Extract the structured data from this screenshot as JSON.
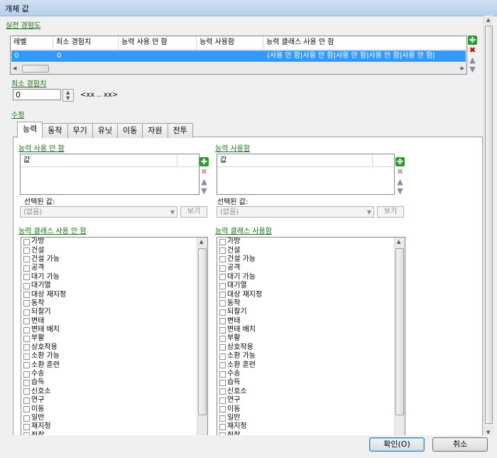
{
  "window": {
    "title": "개체 값"
  },
  "top": {
    "section_label": "실전 경험도",
    "columns": [
      "레벨",
      "최소 경험치",
      "능력 사용 안 함",
      "능력 사용함",
      "능력 클래스 사용 안 함"
    ],
    "row": [
      "0",
      "0",
      "",
      "",
      "(사용 안 함|사용 안 함|사용 안 함|사용 안 함|사용 안 함|"
    ]
  },
  "min_exp": {
    "label": "최소 경험치",
    "value": "0",
    "range": "<xx .. xx>"
  },
  "edit_label": "수정",
  "tabs": [
    "능력",
    "동작",
    "무기",
    "유닛",
    "이동",
    "자원",
    "전투"
  ],
  "left": {
    "list_label": "능력 사용 안 함",
    "list_header": "값",
    "selected_label": "선택된 값:",
    "combo_value": "(없음)",
    "view_button": "보기",
    "class_label": "능력 클래스 사용 안 함"
  },
  "right": {
    "list_label": "능력 사용함",
    "list_header": "값",
    "selected_label": "선택된 값:",
    "combo_value": "(없음)",
    "view_button": "보기",
    "class_label": "능력 클래스 사용함"
  },
  "class_items": [
    "가방",
    "건설",
    "건설 가능",
    "공격",
    "대기 가능",
    "대기열",
    "대상 재지정",
    "동작",
    "되찰기",
    "변태",
    "변태 배치",
    "부활",
    "상호작용",
    "소환 가능",
    "소환 훈련",
    "수송",
    "습득",
    "신호소",
    "연구",
    "이동",
    "일반",
    "재지정",
    "정찰"
  ],
  "buttons": {
    "ok": "확인(O)",
    "cancel": "취소"
  }
}
